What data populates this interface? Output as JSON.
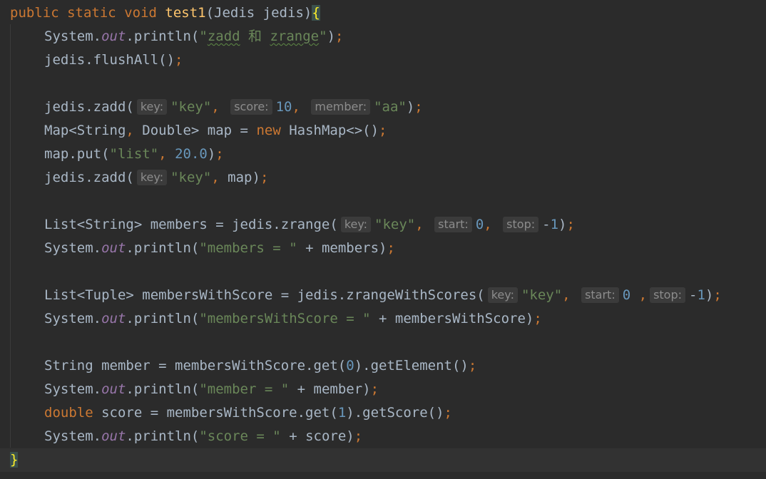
{
  "editor": {
    "colors": {
      "background": "#2b2b2b",
      "current_line": "#323232",
      "keyword": "#cc7832",
      "method_decl": "#ffc66d",
      "string": "#6a8759",
      "number": "#6897bb",
      "static_field": "#9876aa",
      "text": "#a9b7c6",
      "hint_text": "#8c8c8c",
      "hint_bg": "#3b3b3b",
      "brace_highlight": "#ffef28"
    },
    "lines": [
      [
        {
          "t": "public",
          "c": "kw"
        },
        {
          "t": " "
        },
        {
          "t": "static",
          "c": "kw"
        },
        {
          "t": " "
        },
        {
          "t": "void",
          "c": "kw"
        },
        {
          "t": " "
        },
        {
          "t": "test1",
          "c": "fn"
        },
        {
          "t": "(Jedis jedis)"
        },
        {
          "t": "{",
          "c": "brace-match"
        }
      ],
      [
        {
          "t": "System."
        },
        {
          "t": "out",
          "c": "field"
        },
        {
          "t": ".println("
        },
        {
          "t": "\"",
          "c": "str"
        },
        {
          "t": "zadd",
          "c": "str squiggle"
        },
        {
          "t": " 和 ",
          "c": "str"
        },
        {
          "t": "zrange",
          "c": "str squiggle"
        },
        {
          "t": "\"",
          "c": "str"
        },
        {
          "t": ")"
        },
        {
          "t": ";",
          "c": "punct"
        }
      ],
      [
        {
          "t": "jedis.flushAll()"
        },
        {
          "t": ";",
          "c": "punct"
        }
      ],
      [],
      [
        {
          "t": "jedis.zadd("
        },
        {
          "h": "key:"
        },
        {
          "t": "\"key\"",
          "c": "str"
        },
        {
          "t": ",",
          "c": "punct"
        },
        {
          "t": " "
        },
        {
          "h": "score:"
        },
        {
          "t": "10",
          "c": "num"
        },
        {
          "t": ",",
          "c": "punct"
        },
        {
          "t": " "
        },
        {
          "h": "member:"
        },
        {
          "t": "\"aa\"",
          "c": "str"
        },
        {
          "t": ")"
        },
        {
          "t": ";",
          "c": "punct"
        }
      ],
      [
        {
          "t": "Map<String"
        },
        {
          "t": ",",
          "c": "punct"
        },
        {
          "t": " Double> map = "
        },
        {
          "t": "new",
          "c": "kw"
        },
        {
          "t": " HashMap<>()"
        },
        {
          "t": ";",
          "c": "punct"
        }
      ],
      [
        {
          "t": "map.put("
        },
        {
          "t": "\"list\"",
          "c": "str"
        },
        {
          "t": ",",
          "c": "punct"
        },
        {
          "t": " "
        },
        {
          "t": "20.0",
          "c": "num"
        },
        {
          "t": ")"
        },
        {
          "t": ";",
          "c": "punct"
        }
      ],
      [
        {
          "t": "jedis.zadd("
        },
        {
          "h": "key:"
        },
        {
          "t": "\"key\"",
          "c": "str"
        },
        {
          "t": ",",
          "c": "punct"
        },
        {
          "t": " map)"
        },
        {
          "t": ";",
          "c": "punct"
        }
      ],
      [],
      [
        {
          "t": "List<String> members = jedis.zrange("
        },
        {
          "h": "key:"
        },
        {
          "t": "\"key\"",
          "c": "str"
        },
        {
          "t": ",",
          "c": "punct"
        },
        {
          "t": " "
        },
        {
          "h": "start:"
        },
        {
          "t": "0",
          "c": "num"
        },
        {
          "t": ",",
          "c": "punct"
        },
        {
          "t": " "
        },
        {
          "h": "stop:"
        },
        {
          "t": "-"
        },
        {
          "t": "1",
          "c": "num"
        },
        {
          "t": ")"
        },
        {
          "t": ";",
          "c": "punct"
        }
      ],
      [
        {
          "t": "System."
        },
        {
          "t": "out",
          "c": "field"
        },
        {
          "t": ".println("
        },
        {
          "t": "\"members = \"",
          "c": "str"
        },
        {
          "t": " + members)"
        },
        {
          "t": ";",
          "c": "punct"
        }
      ],
      [],
      [
        {
          "t": "List<Tuple> membersWithScore = jedis.zrangeWithScores("
        },
        {
          "h": "key:"
        },
        {
          "t": "\"key\"",
          "c": "str"
        },
        {
          "t": ",",
          "c": "punct"
        },
        {
          "t": " "
        },
        {
          "h": "start:"
        },
        {
          "t": "0",
          "c": "num"
        },
        {
          "t": " ,",
          "c": "punct"
        },
        {
          "h": "stop:"
        },
        {
          "t": "-"
        },
        {
          "t": "1",
          "c": "num"
        },
        {
          "t": ")"
        },
        {
          "t": ";",
          "c": "punct"
        }
      ],
      [
        {
          "t": "System."
        },
        {
          "t": "out",
          "c": "field"
        },
        {
          "t": ".println("
        },
        {
          "t": "\"membersWithScore = \"",
          "c": "str"
        },
        {
          "t": " + membersWithScore)"
        },
        {
          "t": ";",
          "c": "punct"
        }
      ],
      [],
      [
        {
          "t": "String member = membersWithScore.get("
        },
        {
          "t": "0",
          "c": "num"
        },
        {
          "t": ").getElement()"
        },
        {
          "t": ";",
          "c": "punct"
        }
      ],
      [
        {
          "t": "System."
        },
        {
          "t": "out",
          "c": "field"
        },
        {
          "t": ".println("
        },
        {
          "t": "\"member = \"",
          "c": "str"
        },
        {
          "t": " + member)"
        },
        {
          "t": ";",
          "c": "punct"
        }
      ],
      [
        {
          "t": "double",
          "c": "kw"
        },
        {
          "t": " score = membersWithScore.get("
        },
        {
          "t": "1",
          "c": "num"
        },
        {
          "t": ").getScore()"
        },
        {
          "t": ";",
          "c": "punct"
        }
      ],
      [
        {
          "t": "System."
        },
        {
          "t": "out",
          "c": "field"
        },
        {
          "t": ".println("
        },
        {
          "t": "\"score = \"",
          "c": "str"
        },
        {
          "t": " + score)"
        },
        {
          "t": ";",
          "c": "punct"
        }
      ],
      [
        {
          "t": "}",
          "c": "brace-match"
        }
      ]
    ]
  }
}
